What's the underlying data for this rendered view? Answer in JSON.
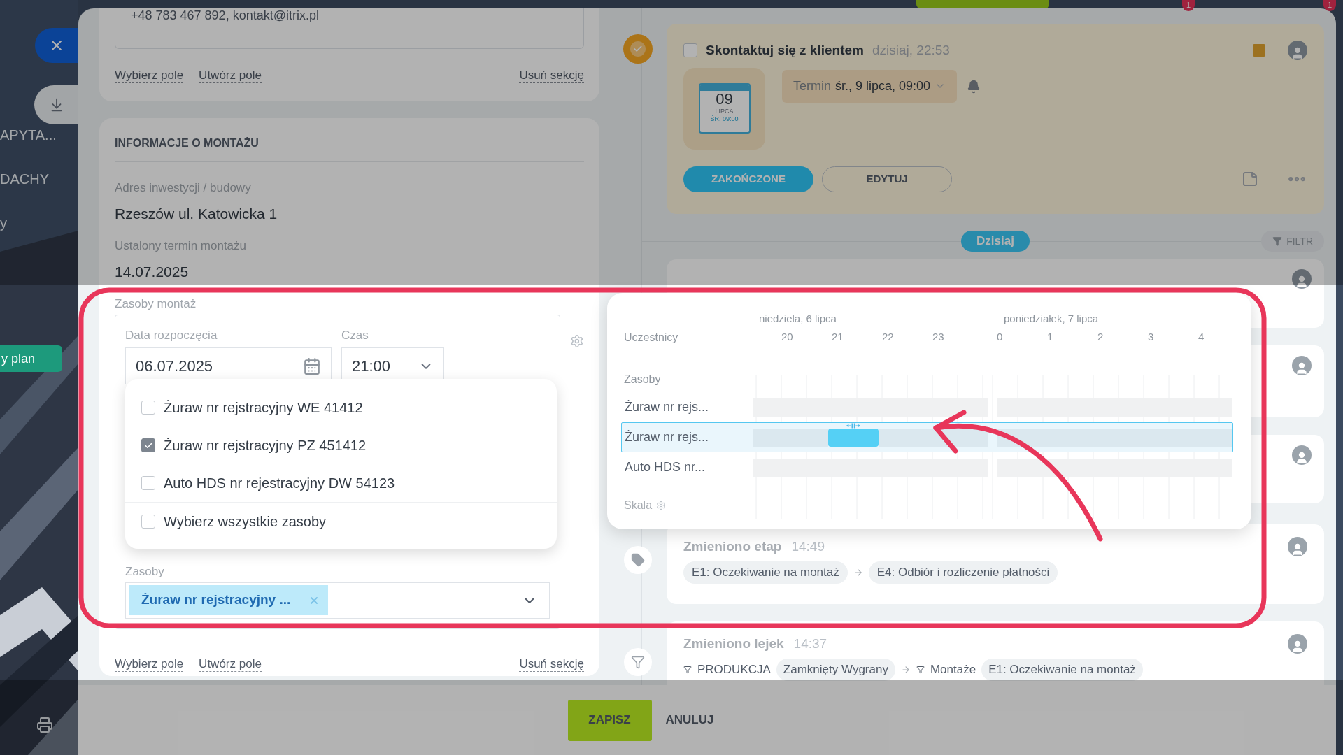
{
  "sidebar": {
    "items": [
      {
        "label": "APYTA..."
      },
      {
        "label": "DACHY"
      },
      {
        "label": "y"
      }
    ],
    "plan_button": "y plan"
  },
  "top_badges": [
    "1",
    "1"
  ],
  "contact_card": {
    "value": "+48 783 467 892, kontakt@itrix.pl",
    "links": [
      "Wybierz pole",
      "Utwórz pole"
    ],
    "remove_link": "Usuń sekcję"
  },
  "montage_card": {
    "title": "INFORMACJE O MONTAŻU",
    "fields": [
      {
        "label": "Adres inwestycji / budowy",
        "value": "Rzeszów ul. Katowicka 1"
      },
      {
        "label": "Ustalony termin montażu",
        "value": "14.07.2025"
      }
    ],
    "resources_section": {
      "label": "Zasoby montaż",
      "start_label": "Data rozpoczęcia",
      "start_value": "06.07.2025",
      "time_label": "Czas",
      "time_value": "21:00",
      "resources_label": "Zasoby",
      "selected_tags": [
        {
          "label": "Żuraw nr rejstracyjny ..."
        }
      ]
    },
    "links": [
      "Wybierz pole",
      "Utwórz pole"
    ],
    "remove_link": "Usuń sekcję"
  },
  "resource_dropdown": {
    "options": [
      {
        "label": "Żuraw nr rejstracyjny WE 41412",
        "checked": false
      },
      {
        "label": "Żuraw nr rejstracyjny PZ 451412",
        "checked": true
      },
      {
        "label": "Auto HDS nr rejestracyjny DW 54123",
        "checked": false
      }
    ],
    "select_all": {
      "label": "Wybierz wszystkie zasoby",
      "checked": false
    }
  },
  "task": {
    "title": "Skontaktuj się z klientem",
    "time": "dzisiaj, 22:53",
    "done": false,
    "calendar": {
      "day": "09",
      "month": "LIPCA",
      "weekday_time": "ŚR. 09:00"
    },
    "deadline_label": "Termin",
    "deadline_value": "śr., 9 lipca, 09:00",
    "buttons": [
      "ZAKOŃCZONE",
      "EDYTUJ"
    ]
  },
  "timeline_divider": "Dzisiaj",
  "filter_button": "FILTR",
  "planner": {
    "days": [
      {
        "label": "niedziela, 6 lipca",
        "hours": [
          {
            "label": "20",
            "booked": false
          },
          {
            "label": "21",
            "booked": true
          },
          {
            "label": "22",
            "booked": false
          },
          {
            "label": "23",
            "booked": false
          }
        ]
      },
      {
        "label": "poniedziałek, 7 lipca",
        "hours": [
          {
            "label": "0",
            "booked": false
          },
          {
            "label": "1",
            "booked": false
          },
          {
            "label": "2",
            "booked": false
          },
          {
            "label": "3",
            "booked": false
          },
          {
            "label": "4",
            "booked": false
          }
        ]
      }
    ],
    "participants_label": "Uczestnicy",
    "resources_label": "Zasoby",
    "resources": [
      {
        "name": "Żuraw nr rejs...",
        "selected": false
      },
      {
        "name": "Żuraw nr rejs...",
        "selected": true
      },
      {
        "name": "Auto HDS nr...",
        "selected": false
      }
    ],
    "scale_label": "Skala"
  },
  "events": [
    {
      "kind": "stage",
      "title": "Zmieniono etap",
      "time": "14:49",
      "from": "E1: Oczekiwanie na montaż",
      "to": "E4: Odbiór i rozliczenie płatności"
    },
    {
      "kind": "funnel",
      "title": "Zmieniono lejek",
      "time": "14:37",
      "from_funnel": "PRODUKCJA",
      "from": "Zamknięty Wygrany",
      "to_funnel": "Montaże",
      "to": "E1: Oczekiwanie na montaż"
    }
  ],
  "footer": {
    "save": "ZAPISZ",
    "cancel": "ANULUJ"
  }
}
